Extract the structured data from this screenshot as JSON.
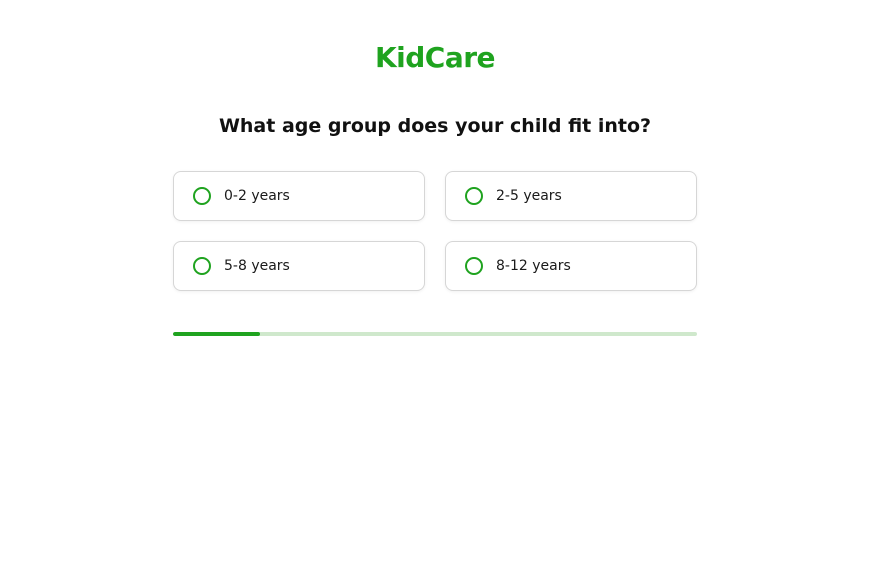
{
  "brand": {
    "name": "KidCare"
  },
  "colors": {
    "accent": "#1fa31f",
    "progress_track": "#cfe8cc",
    "border": "#d6d6d6",
    "text": "#111111"
  },
  "question": {
    "text": "What age group does your child fit into?"
  },
  "options": [
    {
      "label": "0-2 years",
      "selected": false
    },
    {
      "label": "2-5 years",
      "selected": false
    },
    {
      "label": "5-8 years",
      "selected": false
    },
    {
      "label": "8-12 years",
      "selected": false
    }
  ],
  "progress": {
    "fraction": 0.166
  }
}
